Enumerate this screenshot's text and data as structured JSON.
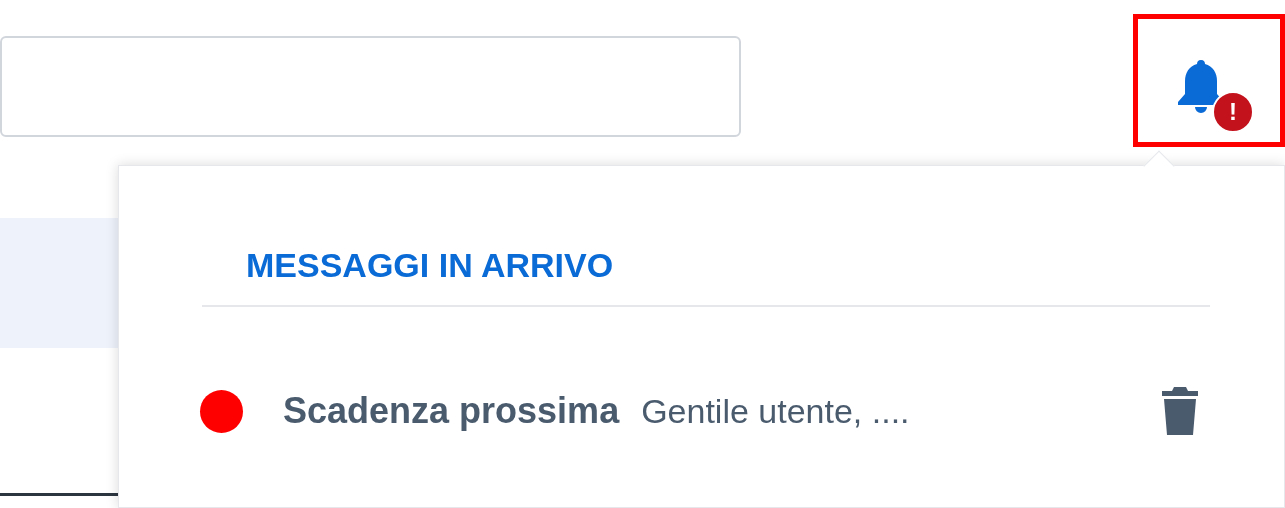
{
  "notifications": {
    "highlighted": true,
    "badge": "!",
    "open": true
  },
  "panel": {
    "title": "MESSAGGI IN ARRIVO",
    "messages": [
      {
        "subject": "Scadenza prossima",
        "preview": "Gentile utente, ....",
        "unread": true
      }
    ]
  }
}
